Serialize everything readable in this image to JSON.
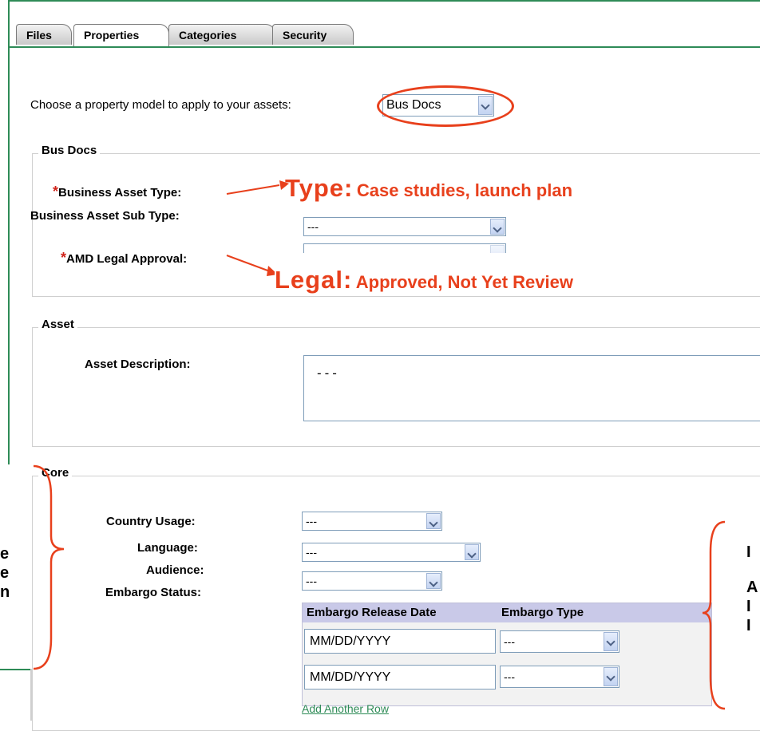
{
  "tabs": [
    {
      "label": "Files"
    },
    {
      "label": "Properties"
    },
    {
      "label": "Categories"
    },
    {
      "label": "Security"
    }
  ],
  "model": {
    "prompt": "Choose a property model to apply to your assets:",
    "selected": "Bus Docs"
  },
  "busdocs": {
    "legend": "Bus Docs",
    "type_label": "Business Asset Type:",
    "subtype_label": "Business Asset Sub Type:",
    "subtype_value": "---",
    "legal_label": "AMD Legal Approval:",
    "required_mark": "*"
  },
  "annotations": {
    "type_key": "Type:",
    "type_text": "Case studies, launch plan",
    "legal_key": "Legal:",
    "legal_text": "Approved, Not Yet Review"
  },
  "asset": {
    "legend": "Asset",
    "desc_label": "Asset Description:",
    "desc_value": "---"
  },
  "core": {
    "legend": "Core",
    "country_label": "Country Usage:",
    "country_value": "---",
    "language_label": "Language:",
    "language_value": "---",
    "audience_label": "Audience:",
    "audience_value": "---",
    "embargo_label": "Embargo Status:",
    "embargo_col1": "Embargo Release Date",
    "embargo_col2": "Embargo Type",
    "rows": [
      {
        "date": "MM/DD/YYYY",
        "type": "---"
      },
      {
        "date": "MM/DD/YYYY",
        "type": "---"
      }
    ],
    "add_row": "Add Another Row"
  },
  "side": {
    "left_lines": [
      "e",
      "e",
      "n"
    ],
    "right_lines": [
      "I",
      "A",
      "I",
      "I"
    ]
  },
  "colors": {
    "annotation": "#e8401c",
    "panel_border": "#2e8b57",
    "link": "#2e8b57"
  }
}
